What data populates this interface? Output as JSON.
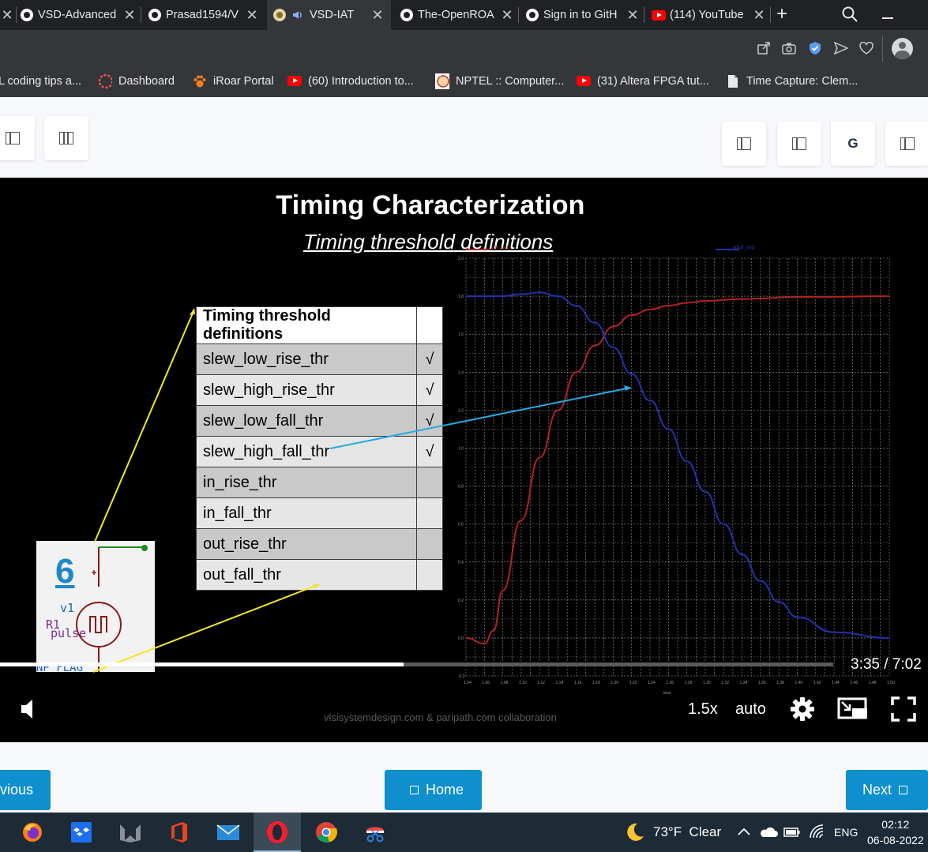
{
  "browser": {
    "tabs": [
      {
        "title": "VSD-Advanced",
        "icon": "github-icon"
      },
      {
        "title": "Prasad1594/V",
        "icon": "github-icon"
      },
      {
        "title": "VSD-IAT",
        "icon": "vsd-favicon",
        "active": true,
        "audio": true
      },
      {
        "title": "The-OpenROA",
        "icon": "github-icon"
      },
      {
        "title": "Sign in to GitH",
        "icon": "github-icon"
      },
      {
        "title": "(114) YouTube",
        "icon": "youtube-icon"
      }
    ],
    "bookmarks": [
      {
        "label": "L coding tips a...",
        "icon": "none"
      },
      {
        "label": "Dashboard",
        "icon": "dashboard-icon"
      },
      {
        "label": "iRoar Portal",
        "icon": "paw-icon"
      },
      {
        "label": "(60) Introduction to...",
        "icon": "youtube-icon"
      },
      {
        "label": "NPTEL :: Computer...",
        "icon": "nptel-icon"
      },
      {
        "label": "(31) Altera FPGA tut...",
        "icon": "youtube-icon"
      },
      {
        "label": "Time Capture: Clem...",
        "icon": "document-icon"
      }
    ]
  },
  "header": {
    "right_letter_button": "G"
  },
  "slide": {
    "title": "Timing Characterization",
    "subtitle": "Timing threshold definitions",
    "table": {
      "header": "Timing threshold definitions",
      "rows": [
        {
          "name": "slew_low_rise_thr",
          "check": "√"
        },
        {
          "name": "slew_high_rise_thr",
          "check": "√"
        },
        {
          "name": "slew_low_fall_thr",
          "check": "√"
        },
        {
          "name": "slew_high_fall_thr",
          "check": "√"
        },
        {
          "name": "in_rise_thr",
          "check": ""
        },
        {
          "name": "in_fall_thr",
          "check": ""
        },
        {
          "name": "out_rise_thr",
          "check": ""
        },
        {
          "name": "out_fall_thr",
          "check": ""
        }
      ]
    },
    "schematic": {
      "number": "6",
      "v1": "v1",
      "r1": "R1",
      "pulse": "pulse",
      "flag": "NP FLAG"
    },
    "legend": {
      "a": "v(in_out)",
      "b": "v(buf_out)"
    },
    "watermark": "vlsisystemdesign.com & paripath.com collaboration",
    "colors": {
      "rise": "#b22222",
      "fall": "#2233aa",
      "arrow_yellow": "#f2e626",
      "arrow_blue": "#29a8e0"
    }
  },
  "chart_data": {
    "type": "line",
    "xlabel": "time",
    "xlim": [
      1.04,
      1.5
    ],
    "ylim": [
      -0.2,
      2.0
    ],
    "yticks": [
      "2.0",
      "1.8",
      "1.6",
      "1.4",
      "1.2",
      "1.0",
      "0.8",
      "0.6",
      "0.4",
      "0.2",
      "0.0",
      "-0.2"
    ],
    "xticks": [
      "1.04",
      "1.06",
      "1.08",
      "1.10",
      "1.12",
      "1.14",
      "1.16",
      "1.18",
      "1.20",
      "1.22",
      "1.24",
      "1.26",
      "1.28",
      "1.30",
      "1.32",
      "1.34",
      "1.36",
      "1.38",
      "1.40",
      "1.42",
      "1.44",
      "1.46",
      "1.48",
      "1.50"
    ],
    "grid": true,
    "series": [
      {
        "name": "v(in_out)",
        "color": "#b22222",
        "x": [
          1.04,
          1.06,
          1.07,
          1.08,
          1.1,
          1.12,
          1.14,
          1.16,
          1.18,
          1.2,
          1.22,
          1.24,
          1.26,
          1.28,
          1.3,
          1.34,
          1.4,
          1.5
        ],
        "y": [
          0.0,
          -0.03,
          0.04,
          0.25,
          0.62,
          0.95,
          1.2,
          1.4,
          1.54,
          1.64,
          1.7,
          1.73,
          1.75,
          1.765,
          1.775,
          1.785,
          1.795,
          1.8
        ]
      },
      {
        "name": "v(buf_out)",
        "color": "#2233aa",
        "x": [
          1.04,
          1.08,
          1.1,
          1.12,
          1.14,
          1.16,
          1.18,
          1.2,
          1.22,
          1.24,
          1.26,
          1.28,
          1.3,
          1.32,
          1.34,
          1.36,
          1.38,
          1.4,
          1.44,
          1.5
        ],
        "y": [
          1.8,
          1.8,
          1.81,
          1.82,
          1.8,
          1.75,
          1.66,
          1.53,
          1.39,
          1.25,
          1.1,
          0.93,
          0.77,
          0.6,
          0.44,
          0.3,
          0.19,
          0.11,
          0.03,
          0.0
        ]
      }
    ]
  },
  "player": {
    "time": "3:35 / 7:02",
    "speed": "1.5x",
    "quality": "auto",
    "progress_fraction": 0.484
  },
  "nav": {
    "previous": "Previous",
    "home": "Home",
    "next": "Next"
  },
  "taskbar": {
    "weather": "73°F  Clear",
    "lang": "ENG",
    "time": "02:12",
    "date": "06-08-2022"
  }
}
